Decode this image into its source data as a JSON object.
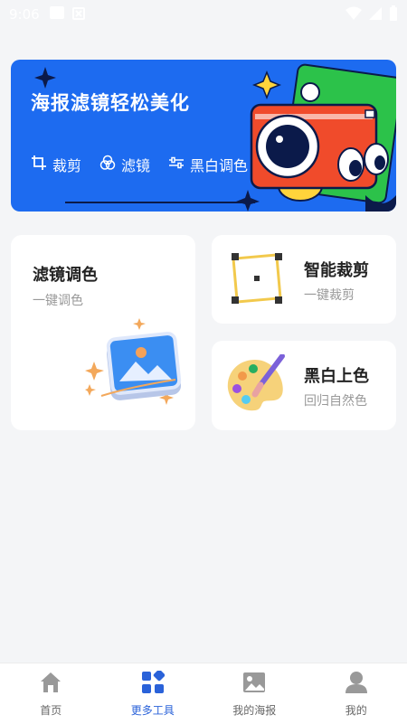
{
  "status_bar": {
    "time": "9:06"
  },
  "banner": {
    "title": "海报滤镜轻松美化",
    "features": [
      {
        "icon": "crop-icon",
        "label": "裁剪"
      },
      {
        "icon": "filter-circles-icon",
        "label": "滤镜"
      },
      {
        "icon": "sliders-icon",
        "label": "黑白调色"
      }
    ],
    "colors": {
      "background": "#1d6bf0",
      "camera_red": "#f04b2b",
      "green": "#2cc24a",
      "yellow": "#ffd43b"
    }
  },
  "cards": [
    {
      "title": "滤镜调色",
      "subtitle": "一键调色"
    },
    {
      "title": "智能裁剪",
      "subtitle": "一键裁剪"
    },
    {
      "title": "黑白上色",
      "subtitle": "回归自然色"
    }
  ],
  "bottom_nav": {
    "items": [
      {
        "label": "首页",
        "icon": "home-icon"
      },
      {
        "label": "更多工具",
        "icon": "grid-tools-icon",
        "active": true
      },
      {
        "label": "我的海报",
        "icon": "image-icon"
      },
      {
        "label": "我的",
        "icon": "user-icon"
      }
    ],
    "active_color": "#2a62d9"
  }
}
